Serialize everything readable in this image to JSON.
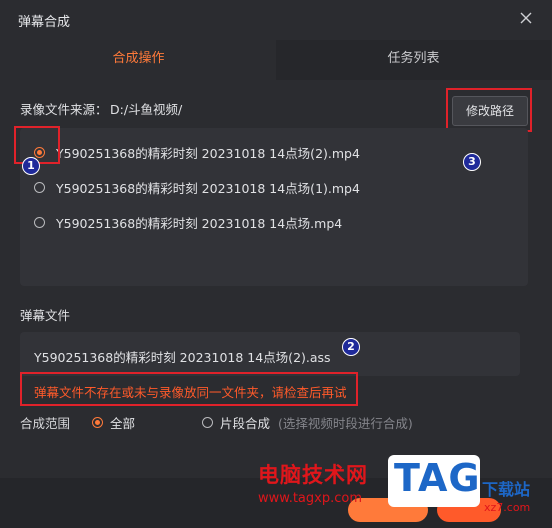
{
  "window": {
    "title": "弹幕合成"
  },
  "tabs": [
    {
      "label": "合成操作",
      "active": true
    },
    {
      "label": "任务列表",
      "active": false
    }
  ],
  "source": {
    "label": "录像文件来源：",
    "path": "D:/斗鱼视频/",
    "modify_button": "修改路径"
  },
  "files": [
    {
      "name": "Y590251368的精彩时刻 20231018 14点场(2).mp4",
      "selected": true
    },
    {
      "name": "Y590251368的精彩时刻 20231018 14点场(1).mp4",
      "selected": false
    },
    {
      "name": "Y590251368的精彩时刻 20231018 14点场.mp4",
      "selected": false
    }
  ],
  "danmaku": {
    "section_label": "弹幕文件",
    "file_name": "Y590251368的精彩时刻 20231018 14点场(2).ass",
    "error": "弹幕文件不存在或未与录像放同一文件夹，请检查后再试"
  },
  "range": {
    "label": "合成范围",
    "options": [
      {
        "label": "全部",
        "selected": true
      },
      {
        "label": "片段合成",
        "selected": false,
        "hint": "(选择视频时段进行合成)"
      }
    ]
  },
  "annotations": [
    "1",
    "2",
    "3"
  ],
  "watermark": {
    "site_name": "电脑技术网",
    "url": "www.tagxp.com",
    "logo": "TAG",
    "side_text": "下载站",
    "side_url": "xz7.com"
  },
  "colors": {
    "accent": "#ff7a3a",
    "error": "#ff5a2a",
    "highlight_box": "#e0222a",
    "badge": "#1f2a9a"
  }
}
